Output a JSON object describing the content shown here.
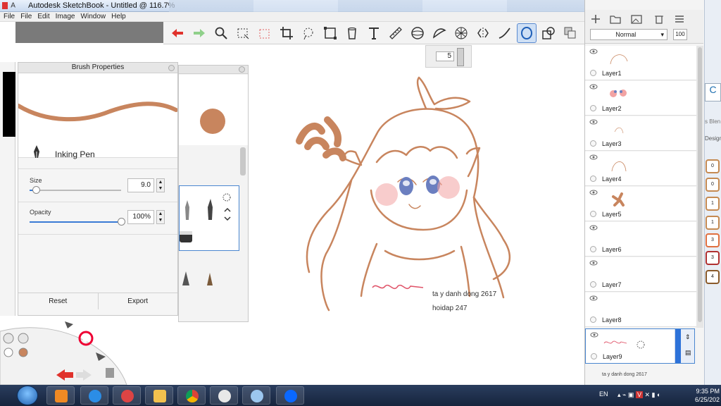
{
  "window": {
    "app_letters": "A",
    "title": "Autodesk SketchBook - Untitled @ 116.7%"
  },
  "menu": [
    "File",
    "File",
    "Edit",
    "Image",
    "Window",
    "Help"
  ],
  "toolbar": {
    "tools": [
      "undo-icon",
      "redo-icon",
      "zoom-icon",
      "rect-select-icon",
      "select-dashed-icon",
      "crop-icon",
      "lasso-icon",
      "transform-icon",
      "bucket-icon",
      "text-icon",
      "ruler-icon",
      "ellipse-icon",
      "french-curve-icon",
      "perspective-icon",
      "symmetry-icon",
      "stroke-icon",
      "circle-tool-icon",
      "copy-layers-icon",
      "paste-icon"
    ],
    "active_tool": "circle-tool-icon"
  },
  "size_chip": {
    "value": "5"
  },
  "brush_properties": {
    "title": "Brush Properties",
    "brush_name": "Inking Pen",
    "size_label": "Size",
    "size_value": "9.0",
    "size_fraction": 0.07,
    "opacity_label": "Opacity",
    "opacity_value": "100%",
    "opacity_fraction": 1.0,
    "reset_label": "Reset",
    "export_label": "Export",
    "brush_color": "#c8855e"
  },
  "canvas": {
    "stroke_color": "#c8855e",
    "line1": "ta y danh dong 2617",
    "line2": "hoidap 247"
  },
  "layers": {
    "blend_mode": "Normal",
    "opacity": "100",
    "items": [
      {
        "name": "Layer1"
      },
      {
        "name": "Layer2"
      },
      {
        "name": "Layer3"
      },
      {
        "name": "Layer4"
      },
      {
        "name": "Layer5"
      },
      {
        "name": "Layer6"
      },
      {
        "name": "Layer7"
      },
      {
        "name": "Layer8"
      },
      {
        "name": "Layer9"
      }
    ],
    "selected": "Layer9",
    "partial_next": "ta y danh dong 2617"
  },
  "right_edge": {
    "frag1": "C",
    "frag2": "s Blen",
    "frag3": "Design",
    "swatches": [
      "0",
      "0",
      "1",
      "1",
      "3",
      "3",
      "4"
    ]
  },
  "taskbar": {
    "lang": "EN",
    "time": "9:35 PM",
    "date": "6/25/202"
  }
}
